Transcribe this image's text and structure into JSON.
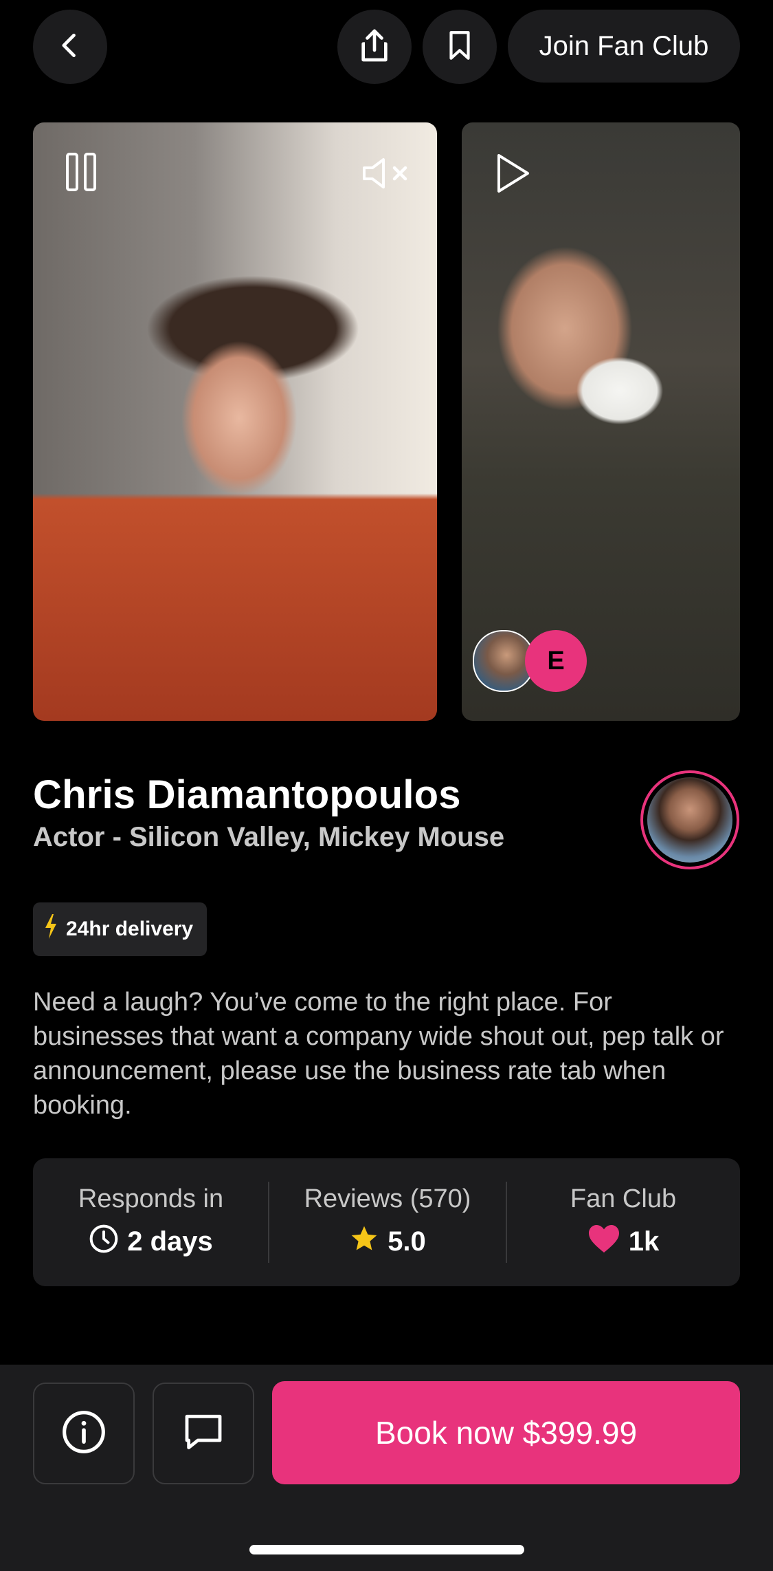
{
  "header": {
    "join_label": "Join Fan Club"
  },
  "videos": [
    {
      "state": "playing",
      "muted": true
    },
    {
      "state": "paused",
      "avatar_letter": "E"
    }
  ],
  "profile": {
    "name": "Chris Diamantopoulos",
    "subtitle": "Actor - Silicon Valley, Mickey Mouse",
    "badge": "24hr delivery",
    "description": "Need a laugh? You’ve come to the right place. For businesses that want a company wide shout out, pep talk or announcement, please use the business rate tab when booking."
  },
  "stats": {
    "responds": {
      "label": "Responds in",
      "value": "2 days"
    },
    "reviews": {
      "label": "Reviews (570)",
      "value": "5.0"
    },
    "fanclub": {
      "label": "Fan Club",
      "value": "1k"
    }
  },
  "footer": {
    "book_label": "Book now $399.99"
  },
  "colors": {
    "accent": "#e8337c",
    "star": "#f5c518",
    "bolt": "#f5c518",
    "surface": "#1c1c1e"
  }
}
